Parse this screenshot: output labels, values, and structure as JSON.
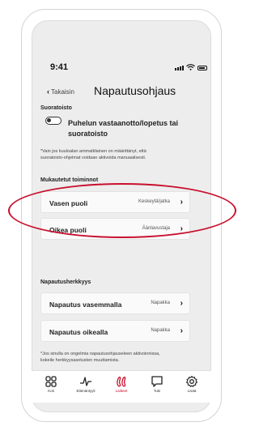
{
  "status": {
    "time": "9:41"
  },
  "header": {
    "back_label": "Takaisin",
    "title": "Napautusohjaus"
  },
  "suoratoisto": {
    "section_label": "Suoratoisto",
    "toggle_label": "Puhelun vastaanotto/lopetus tai suoratoisto",
    "toggle_on": false,
    "note_line1": "*Vain jos kuuloalan ammattilainen on määrittänyt, että",
    "note_line2": "suoratoisto-ohjelmat voidaan aktivoida manuaalisesti."
  },
  "mukautetut": {
    "section_label": "Mukautetut toiminnot",
    "items": [
      {
        "label": "Vasen puoli",
        "value": "Keskeytä/jatka"
      },
      {
        "label": "Oikea puoli",
        "value": "Äänlavustaja"
      }
    ]
  },
  "herkkyys": {
    "section_label": "Napautusherkkyys",
    "items": [
      {
        "label": "Napautus vasemmalla",
        "value": "Napakka"
      },
      {
        "label": "Napautus oikealla",
        "value": "Napakka"
      }
    ],
    "note_line1": "*Jos sinulla on ongelmia napautusohjauseleen aktivoinnissa,",
    "note_line2": "kokeile herkkyysasetusten muuttamista."
  },
  "tabbar": {
    "active": "Laitteet",
    "accent_color": "#c8102e",
    "tabs": [
      {
        "label": "Koti",
        "icon": "home-grid-icon"
      },
      {
        "label": "Elämäntyyli",
        "icon": "activity-icon"
      },
      {
        "label": "Laitteet",
        "icon": "hearing-aids-icon"
      },
      {
        "label": "Tuki",
        "icon": "chat-icon"
      },
      {
        "label": "Lisää",
        "icon": "gear-icon"
      }
    ]
  },
  "annotation": {
    "highlight_color": "#c8102e",
    "target": "Vasen puoli"
  }
}
